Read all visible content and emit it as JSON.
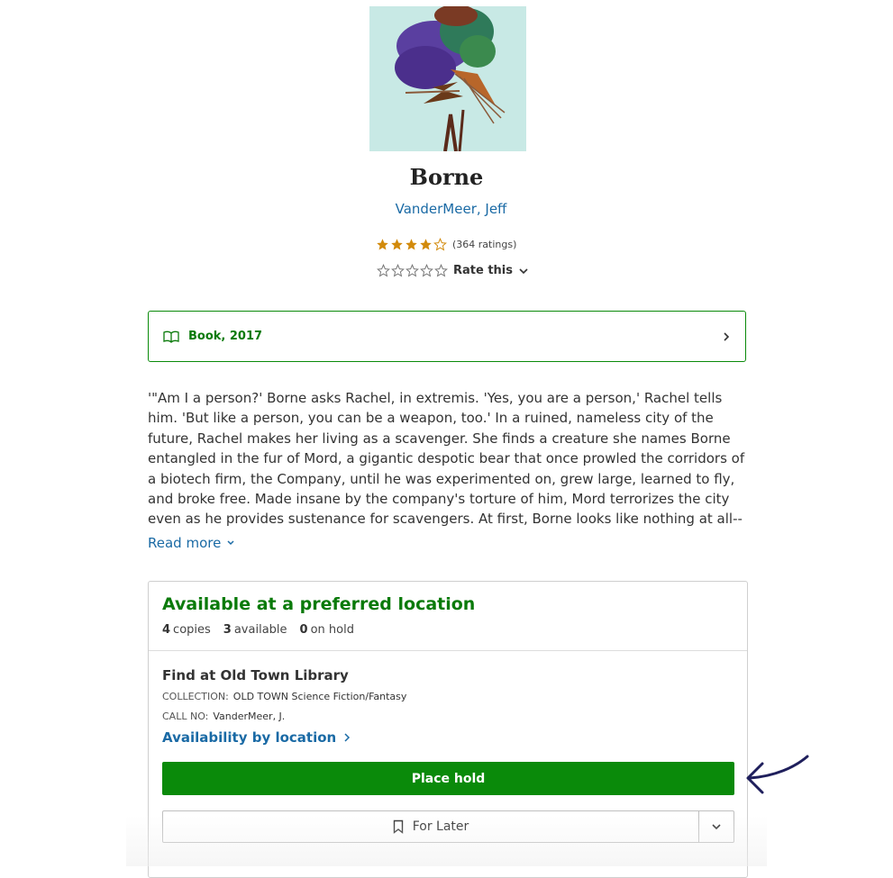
{
  "book": {
    "title": "Borne",
    "author": "VanderMeer, Jeff",
    "rating": 4,
    "ratings_count": "(364 ratings)",
    "rate_label": "Rate this"
  },
  "format": {
    "label": "Book, 2017",
    "icon": "open-book-icon"
  },
  "description": {
    "text": "'\"Am I a person?' Borne asks Rachel, in extremis. 'Yes, you are a person,' Rachel tells him. 'But like a person, you can be a weapon, too.' In a ruined, nameless city of the future, Rachel makes her living as a scavenger. She finds a creature she names Borne entangled in the fur of Mord, a gigantic despotic bear that once prowled the corridors of a biotech firm, the Company, until he was experimented on, grew large, learned to fly, and broke free. Made insane by the company's torture of him, Mord terrorizes the city even as he provides sustenance for scavengers. At first, Borne looks like nothing at all--just a green lump that might be a discard from the Company,",
    "read_more": "Read more"
  },
  "availability": {
    "heading": "Available at a preferred location",
    "copies_num": "4",
    "copies_label": "copies",
    "available_num": "3",
    "available_label": "available",
    "hold_num": "0",
    "hold_label": "on hold",
    "find_at": "Find at Old Town Library",
    "collection_label": "COLLECTION:",
    "collection_value": "OLD TOWN Science Fiction/Fantasy",
    "callno_label": "CALL NO:",
    "callno_value": "VanderMeer, J.",
    "availability_link": "Availability by location",
    "place_hold": "Place hold",
    "for_later": "For Later"
  },
  "colors": {
    "accent_green": "#0a8a0a",
    "link_blue": "#1a6aa5",
    "star_gold": "#d28a0b",
    "annotation_navy": "#1f1f5c"
  }
}
